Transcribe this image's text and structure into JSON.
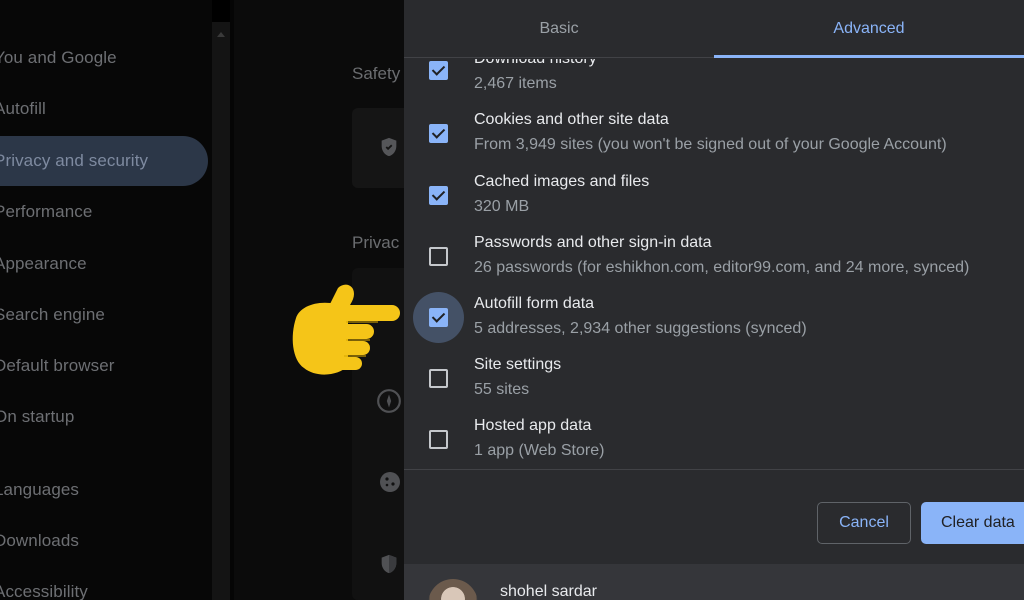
{
  "sidebar": {
    "items": [
      {
        "label": "You and Google"
      },
      {
        "label": "Autofill"
      },
      {
        "label": "Privacy and security",
        "active": true
      },
      {
        "label": "Performance"
      },
      {
        "label": "Appearance"
      },
      {
        "label": "Search engine"
      },
      {
        "label": "Default browser"
      },
      {
        "label": "On startup"
      },
      {
        "label": "Languages"
      },
      {
        "label": "Downloads"
      },
      {
        "label": "Accessibility"
      }
    ]
  },
  "background": {
    "safety_label": "Safety",
    "privacy_label": "Privac"
  },
  "dialog": {
    "tabs": [
      {
        "label": "Basic",
        "selected": false
      },
      {
        "label": "Advanced",
        "selected": true
      }
    ],
    "items": [
      {
        "title": "Download history",
        "subtitle": "2,467 items",
        "checked": true
      },
      {
        "title": "Cookies and other site data",
        "subtitle": "From 3,949 sites (you won't be signed out of your Google Account)",
        "checked": true
      },
      {
        "title": "Cached images and files",
        "subtitle": "320 MB",
        "checked": true
      },
      {
        "title": "Passwords and other sign-in data",
        "subtitle": "26 passwords (for eshikhon.com, editor99.com, and 24 more, synced)",
        "checked": false
      },
      {
        "title": "Autofill form data",
        "subtitle": "5 addresses, 2,934 other suggestions (synced)",
        "checked": true,
        "focused": true
      },
      {
        "title": "Site settings",
        "subtitle": "55 sites",
        "checked": false
      },
      {
        "title": "Hosted app data",
        "subtitle": "1 app (Web Store)",
        "checked": false
      }
    ],
    "cancel_label": "Cancel",
    "clear_label": "Clear data"
  },
  "footer": {
    "user_name": "shohel sardar"
  },
  "colors": {
    "accent": "#8ab4f8",
    "dialog_bg": "#2a2b2e",
    "hand": "#f5c518"
  },
  "icons": {
    "safety": "shield-check-icon",
    "privacy_a": "compass-icon",
    "privacy_b": "cookie-icon",
    "privacy_c": "shield-icon",
    "pointer": "pointing-hand-icon"
  }
}
